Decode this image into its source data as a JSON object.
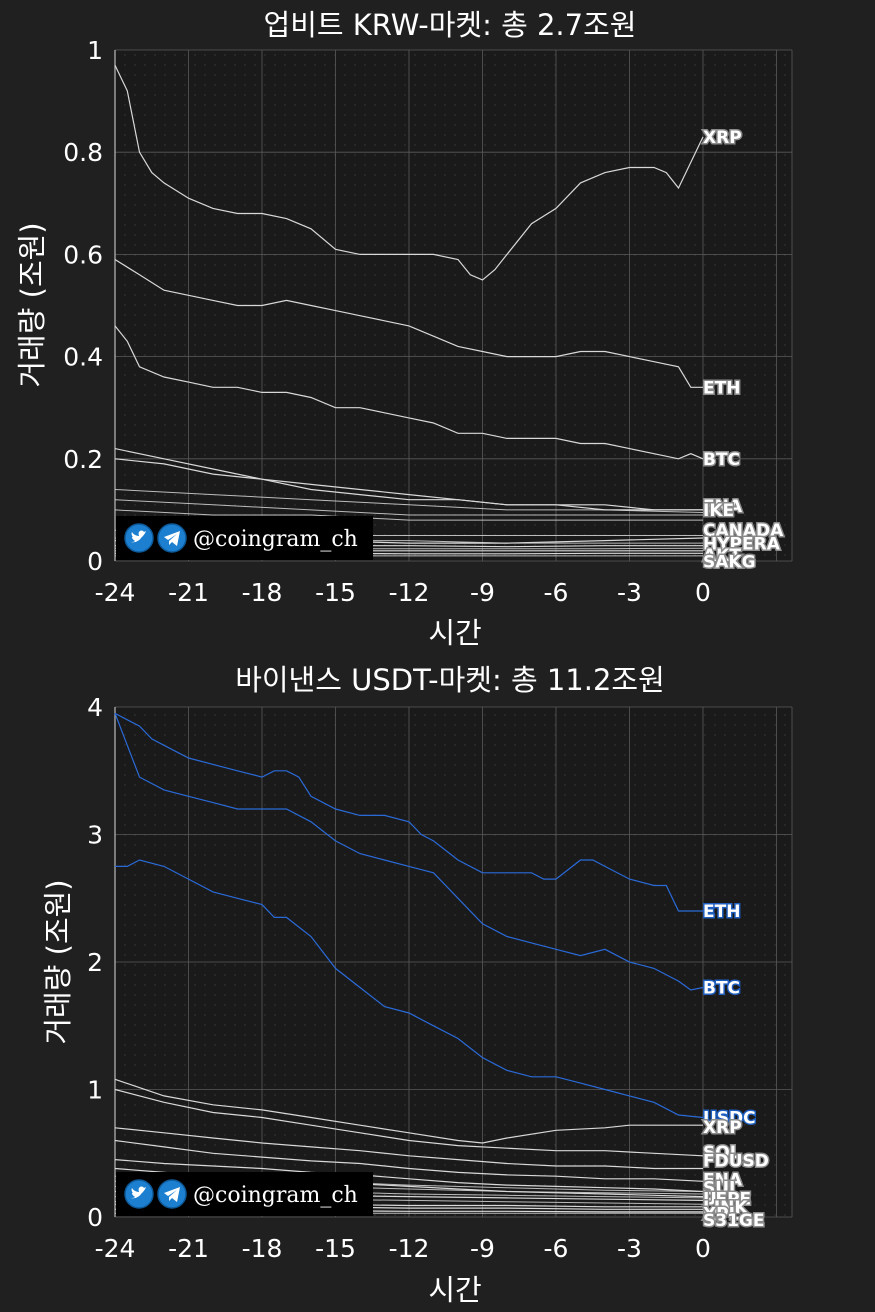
{
  "colors": {
    "background": "#202020",
    "plot_background": "#1a1a1a",
    "grid": "#5a5a5a",
    "line_white": "#d8d8d8",
    "line_blue": "#2a6ad8",
    "label_white_stroke": "#8a8a8a",
    "label_blue_stroke": "#1f5fbf"
  },
  "promo": {
    "handle": "@coingram_ch",
    "icons": [
      "twitter-icon",
      "telegram-icon"
    ]
  },
  "chart_data": [
    {
      "type": "line",
      "title": "업비트 KRW-마켓: 총 2.7조원",
      "xlabel": "시간",
      "ylabel": "거래량 (조원)",
      "xlim": [
        -24,
        0
      ],
      "ylim": [
        0,
        1
      ],
      "xticks": [
        "-24",
        "-21",
        "-18",
        "-15",
        "-12",
        "-9",
        "-6",
        "-3",
        "0"
      ],
      "yticks": [
        "0",
        "0.2",
        "0.4",
        "0.6",
        "0.8",
        "1"
      ],
      "grid": true,
      "series": [
        {
          "name": "XRP",
          "color": "#d8d8d8",
          "x": [
            -24,
            -23.5,
            -23,
            -22.5,
            -22,
            -21,
            -20,
            -19,
            -18,
            -17,
            -16,
            -15,
            -14,
            -13,
            -12,
            -11,
            -10,
            -9.5,
            -9,
            -8.5,
            -8,
            -7,
            -6,
            -5,
            -4,
            -3,
            -2,
            -1.5,
            -1,
            -0.5,
            0
          ],
          "y": [
            0.97,
            0.92,
            0.8,
            0.76,
            0.74,
            0.71,
            0.69,
            0.68,
            0.68,
            0.67,
            0.65,
            0.61,
            0.6,
            0.6,
            0.6,
            0.6,
            0.59,
            0.56,
            0.55,
            0.57,
            0.6,
            0.66,
            0.69,
            0.74,
            0.76,
            0.77,
            0.77,
            0.76,
            0.73,
            0.78,
            0.83
          ]
        },
        {
          "name": "ETH",
          "color": "#d8d8d8",
          "x": [
            -24,
            -23,
            -22,
            -21,
            -20,
            -19,
            -18,
            -17,
            -16,
            -15,
            -14,
            -13,
            -12,
            -11,
            -10,
            -9,
            -8,
            -7,
            -6,
            -5,
            -4,
            -3,
            -2,
            -1,
            -0.5,
            0
          ],
          "y": [
            0.59,
            0.56,
            0.53,
            0.52,
            0.51,
            0.5,
            0.5,
            0.51,
            0.5,
            0.49,
            0.48,
            0.47,
            0.46,
            0.44,
            0.42,
            0.41,
            0.4,
            0.4,
            0.4,
            0.41,
            0.41,
            0.4,
            0.39,
            0.38,
            0.34,
            0.34
          ]
        },
        {
          "name": "BTC",
          "color": "#d8d8d8",
          "x": [
            -24,
            -23.5,
            -23,
            -22,
            -21,
            -20,
            -19,
            -18,
            -17,
            -16,
            -15,
            -14,
            -13,
            -12,
            -11,
            -10,
            -9,
            -8,
            -7,
            -6,
            -5,
            -4,
            -3,
            -2,
            -1,
            -0.5,
            0
          ],
          "y": [
            0.46,
            0.43,
            0.38,
            0.36,
            0.35,
            0.34,
            0.34,
            0.33,
            0.33,
            0.32,
            0.3,
            0.3,
            0.29,
            0.28,
            0.27,
            0.25,
            0.25,
            0.24,
            0.24,
            0.24,
            0.23,
            0.23,
            0.22,
            0.21,
            0.2,
            0.21,
            0.2
          ]
        },
        {
          "name": "ENA",
          "color": "#d8d8d8",
          "x": [
            -24,
            -22,
            -20,
            -18,
            -16,
            -14,
            -12,
            -10,
            -8,
            -6,
            -4,
            -2,
            0
          ],
          "y": [
            0.22,
            0.2,
            0.18,
            0.16,
            0.15,
            0.14,
            0.13,
            0.12,
            0.11,
            0.11,
            0.11,
            0.1,
            0.1
          ]
        },
        {
          "name": "IKE",
          "color": "#d8d8d8",
          "x": [
            -24,
            -22,
            -20,
            -18,
            -16,
            -14,
            -12,
            -10,
            -8,
            -6,
            -4,
            -2,
            0
          ],
          "y": [
            0.2,
            0.19,
            0.17,
            0.16,
            0.14,
            0.13,
            0.12,
            0.12,
            0.11,
            0.11,
            0.1,
            0.1,
            0.1
          ]
        },
        {
          "name": "CANADA",
          "color": "#d8d8d8",
          "x": [
            -24,
            -20,
            -16,
            -12,
            -8,
            -4,
            0
          ],
          "y": [
            0.04,
            0.04,
            0.04,
            0.035,
            0.035,
            0.04,
            0.045
          ]
        },
        {
          "name": "HYPERA",
          "color": "#d8d8d8",
          "x": [
            -24,
            -20,
            -16,
            -12,
            -8,
            -4,
            0
          ],
          "y": [
            0.03,
            0.03,
            0.03,
            0.03,
            0.028,
            0.03,
            0.03
          ]
        },
        {
          "name": "AKT",
          "color": "#d8d8d8",
          "x": [
            -24,
            -20,
            -16,
            -12,
            -8,
            -4,
            0
          ],
          "y": [
            0.02,
            0.02,
            0.02,
            0.02,
            0.02,
            0.02,
            0.02
          ]
        },
        {
          "name": "SAKG",
          "color": "#d8d8d8",
          "x": [
            -24,
            -20,
            -16,
            -12,
            -8,
            -4,
            0
          ],
          "y": [
            0.015,
            0.015,
            0.015,
            0.014,
            0.014,
            0.015,
            0.015
          ]
        }
      ],
      "extra_lines": [
        {
          "x": [
            -24,
            -20,
            -16,
            -12,
            -8,
            -4,
            0
          ],
          "y": [
            0.14,
            0.13,
            0.12,
            0.11,
            0.1,
            0.1,
            0.095
          ]
        },
        {
          "x": [
            -24,
            -20,
            -16,
            -12,
            -8,
            -4,
            0
          ],
          "y": [
            0.12,
            0.11,
            0.1,
            0.09,
            0.09,
            0.09,
            0.09
          ]
        },
        {
          "x": [
            -24,
            -20,
            -16,
            -12,
            -8,
            -4,
            0
          ],
          "y": [
            0.1,
            0.09,
            0.09,
            0.08,
            0.08,
            0.08,
            0.08
          ]
        },
        {
          "x": [
            -24,
            -20,
            -16,
            -12,
            -8,
            -4,
            0
          ],
          "y": [
            0.06,
            0.055,
            0.05,
            0.05,
            0.05,
            0.05,
            0.05
          ]
        },
        {
          "x": [
            -24,
            -20,
            -16,
            -12,
            -8,
            -4,
            0
          ],
          "y": [
            0.045,
            0.04,
            0.04,
            0.04,
            0.035,
            0.035,
            0.035
          ]
        },
        {
          "x": [
            -24,
            -20,
            -16,
            -12,
            -8,
            -4,
            0
          ],
          "y": [
            0.025,
            0.025,
            0.024,
            0.024,
            0.024,
            0.024,
            0.025
          ]
        },
        {
          "x": [
            -24,
            -20,
            -16,
            -12,
            -8,
            -4,
            0
          ],
          "y": [
            0.01,
            0.01,
            0.01,
            0.01,
            0.01,
            0.01,
            0.01
          ]
        }
      ]
    },
    {
      "type": "line",
      "title": "바이낸스 USDT-마켓: 총 11.2조원",
      "xlabel": "시간",
      "ylabel": "거래량 (조원)",
      "xlim": [
        -24,
        0
      ],
      "ylim": [
        0,
        4
      ],
      "xticks": [
        "-24",
        "-21",
        "-18",
        "-15",
        "-12",
        "-9",
        "-6",
        "-3",
        "0"
      ],
      "yticks": [
        "0",
        "1",
        "2",
        "3",
        "4"
      ],
      "grid": true,
      "series": [
        {
          "name": "ETH",
          "color": "#2a6ad8",
          "x": [
            -24,
            -23.5,
            -23,
            -22.5,
            -22,
            -21,
            -20,
            -19,
            -18,
            -17.5,
            -17,
            -16.5,
            -16,
            -15,
            -14,
            -13,
            -12,
            -11.5,
            -11,
            -10,
            -9,
            -8,
            -7,
            -6.5,
            -6,
            -5,
            -4.5,
            -4,
            -3,
            -2,
            -1.5,
            -1,
            0
          ],
          "y": [
            3.95,
            3.9,
            3.85,
            3.75,
            3.7,
            3.6,
            3.55,
            3.5,
            3.45,
            3.5,
            3.5,
            3.45,
            3.3,
            3.2,
            3.15,
            3.15,
            3.1,
            3.0,
            2.95,
            2.8,
            2.7,
            2.7,
            2.7,
            2.65,
            2.65,
            2.8,
            2.8,
            2.75,
            2.65,
            2.6,
            2.6,
            2.4,
            2.4
          ]
        },
        {
          "name": "BTC",
          "color": "#2a6ad8",
          "x": [
            -24,
            -23.5,
            -23,
            -22,
            -21,
            -20,
            -19,
            -18,
            -17,
            -16,
            -15,
            -14,
            -13,
            -12,
            -11,
            -10,
            -9,
            -8,
            -7,
            -6,
            -5,
            -4,
            -3,
            -2,
            -1,
            -0.5,
            0
          ],
          "y": [
            3.95,
            3.7,
            3.45,
            3.35,
            3.3,
            3.25,
            3.2,
            3.2,
            3.2,
            3.1,
            2.95,
            2.85,
            2.8,
            2.75,
            2.7,
            2.5,
            2.3,
            2.2,
            2.15,
            2.1,
            2.05,
            2.1,
            2.0,
            1.95,
            1.85,
            1.78,
            1.8
          ]
        },
        {
          "name": "USDC",
          "color": "#2a6ad8",
          "x": [
            -24,
            -23.5,
            -23,
            -22,
            -21,
            -20,
            -19,
            -18,
            -17.5,
            -17,
            -16,
            -15,
            -14,
            -13,
            -12,
            -11,
            -10,
            -9,
            -8,
            -7,
            -6,
            -5,
            -4,
            -3,
            -2,
            -1,
            0
          ],
          "y": [
            2.75,
            2.75,
            2.8,
            2.75,
            2.65,
            2.55,
            2.5,
            2.45,
            2.35,
            2.35,
            2.2,
            1.95,
            1.8,
            1.65,
            1.6,
            1.5,
            1.4,
            1.25,
            1.15,
            1.1,
            1.1,
            1.05,
            1.0,
            0.95,
            0.9,
            0.8,
            0.78
          ]
        },
        {
          "name": "XRP",
          "color": "#d8d8d8",
          "x": [
            -24,
            -22,
            -20,
            -18,
            -16,
            -14,
            -12,
            -10,
            -9,
            -8,
            -6,
            -4,
            -3,
            -2,
            -1,
            0
          ],
          "y": [
            1.08,
            0.95,
            0.88,
            0.84,
            0.78,
            0.72,
            0.66,
            0.6,
            0.58,
            0.62,
            0.68,
            0.7,
            0.72,
            0.72,
            0.72,
            0.72
          ]
        },
        {
          "name": "SOL",
          "color": "#d8d8d8",
          "x": [
            -24,
            -22,
            -20,
            -18,
            -16,
            -14,
            -12,
            -10,
            -8,
            -6,
            -4,
            -2,
            0
          ],
          "y": [
            1.0,
            0.9,
            0.82,
            0.78,
            0.72,
            0.66,
            0.6,
            0.56,
            0.54,
            0.52,
            0.52,
            0.5,
            0.48
          ]
        },
        {
          "name": "FDUSD",
          "color": "#d8d8d8",
          "x": [
            -24,
            -22,
            -20,
            -18,
            -16,
            -14,
            -12,
            -10,
            -8,
            -6,
            -4,
            -2,
            0
          ],
          "y": [
            0.7,
            0.66,
            0.62,
            0.58,
            0.55,
            0.52,
            0.48,
            0.45,
            0.42,
            0.4,
            0.4,
            0.38,
            0.38
          ]
        },
        {
          "name": "ENA",
          "color": "#d8d8d8",
          "x": [
            -24,
            -22,
            -20,
            -18,
            -16,
            -14,
            -12,
            -10,
            -8,
            -6,
            -4,
            -2,
            0
          ],
          "y": [
            0.6,
            0.55,
            0.5,
            0.47,
            0.44,
            0.42,
            0.38,
            0.35,
            0.33,
            0.32,
            0.3,
            0.3,
            0.28
          ]
        },
        {
          "name": "SUI",
          "color": "#d8d8d8",
          "x": [
            -24,
            -22,
            -20,
            -18,
            -16,
            -14,
            -12,
            -10,
            -8,
            -6,
            -4,
            -2,
            0
          ],
          "y": [
            0.45,
            0.42,
            0.4,
            0.38,
            0.35,
            0.33,
            0.3,
            0.27,
            0.25,
            0.24,
            0.23,
            0.22,
            0.2
          ]
        },
        {
          "name": "PEPE",
          "color": "#d8d8d8",
          "x": [
            -24,
            -22,
            -20,
            -18,
            -16,
            -14,
            -12,
            -10,
            -8,
            -6,
            -4,
            -2,
            0
          ],
          "y": [
            0.38,
            0.35,
            0.32,
            0.3,
            0.28,
            0.26,
            0.24,
            0.22,
            0.2,
            0.19,
            0.18,
            0.17,
            0.16
          ]
        },
        {
          "name": "U",
          "color": "#d8d8d8",
          "x": [
            -24,
            -20,
            -16,
            -12,
            -8,
            -4,
            0
          ],
          "y": [
            0.2,
            0.18,
            0.17,
            0.16,
            0.15,
            0.14,
            0.13
          ]
        },
        {
          "name": "LINK",
          "color": "#d8d8d8",
          "x": [
            -24,
            -20,
            -16,
            -12,
            -8,
            -4,
            0
          ],
          "y": [
            0.12,
            0.11,
            0.1,
            0.09,
            0.09,
            0.08,
            0.08
          ]
        },
        {
          "name": "XPL",
          "color": "#d8d8d8",
          "x": [
            -24,
            -20,
            -16,
            -12,
            -8,
            -4,
            0
          ],
          "y": [
            0.1,
            0.09,
            0.08,
            0.07,
            0.07,
            0.06,
            0.06
          ]
        },
        {
          "name": "S31GE",
          "color": "#d8d8d8",
          "x": [
            -24,
            -20,
            -16,
            -12,
            -8,
            -4,
            0
          ],
          "y": [
            0.06,
            0.05,
            0.05,
            0.045,
            0.045,
            0.04,
            0.04
          ]
        }
      ],
      "extra_lines": [
        {
          "x": [
            -24,
            -20,
            -16,
            -12,
            -8,
            -4,
            0
          ],
          "y": [
            0.32,
            0.3,
            0.28,
            0.25,
            0.23,
            0.21,
            0.2
          ]
        },
        {
          "x": [
            -24,
            -20,
            -16,
            -12,
            -8,
            -4,
            0
          ],
          "y": [
            0.28,
            0.26,
            0.24,
            0.22,
            0.2,
            0.19,
            0.18
          ]
        },
        {
          "x": [
            -24,
            -20,
            -16,
            -12,
            -8,
            -4,
            0
          ],
          "y": [
            0.24,
            0.22,
            0.2,
            0.18,
            0.17,
            0.16,
            0.15
          ]
        },
        {
          "x": [
            -24,
            -20,
            -16,
            -12,
            -8,
            -4,
            0
          ],
          "y": [
            0.16,
            0.15,
            0.14,
            0.13,
            0.12,
            0.11,
            0.1
          ]
        },
        {
          "x": [
            -24,
            -20,
            -16,
            -12,
            -8,
            -4,
            0
          ],
          "y": [
            0.03,
            0.03,
            0.03,
            0.03,
            0.03,
            0.03,
            0.03
          ]
        }
      ]
    }
  ]
}
